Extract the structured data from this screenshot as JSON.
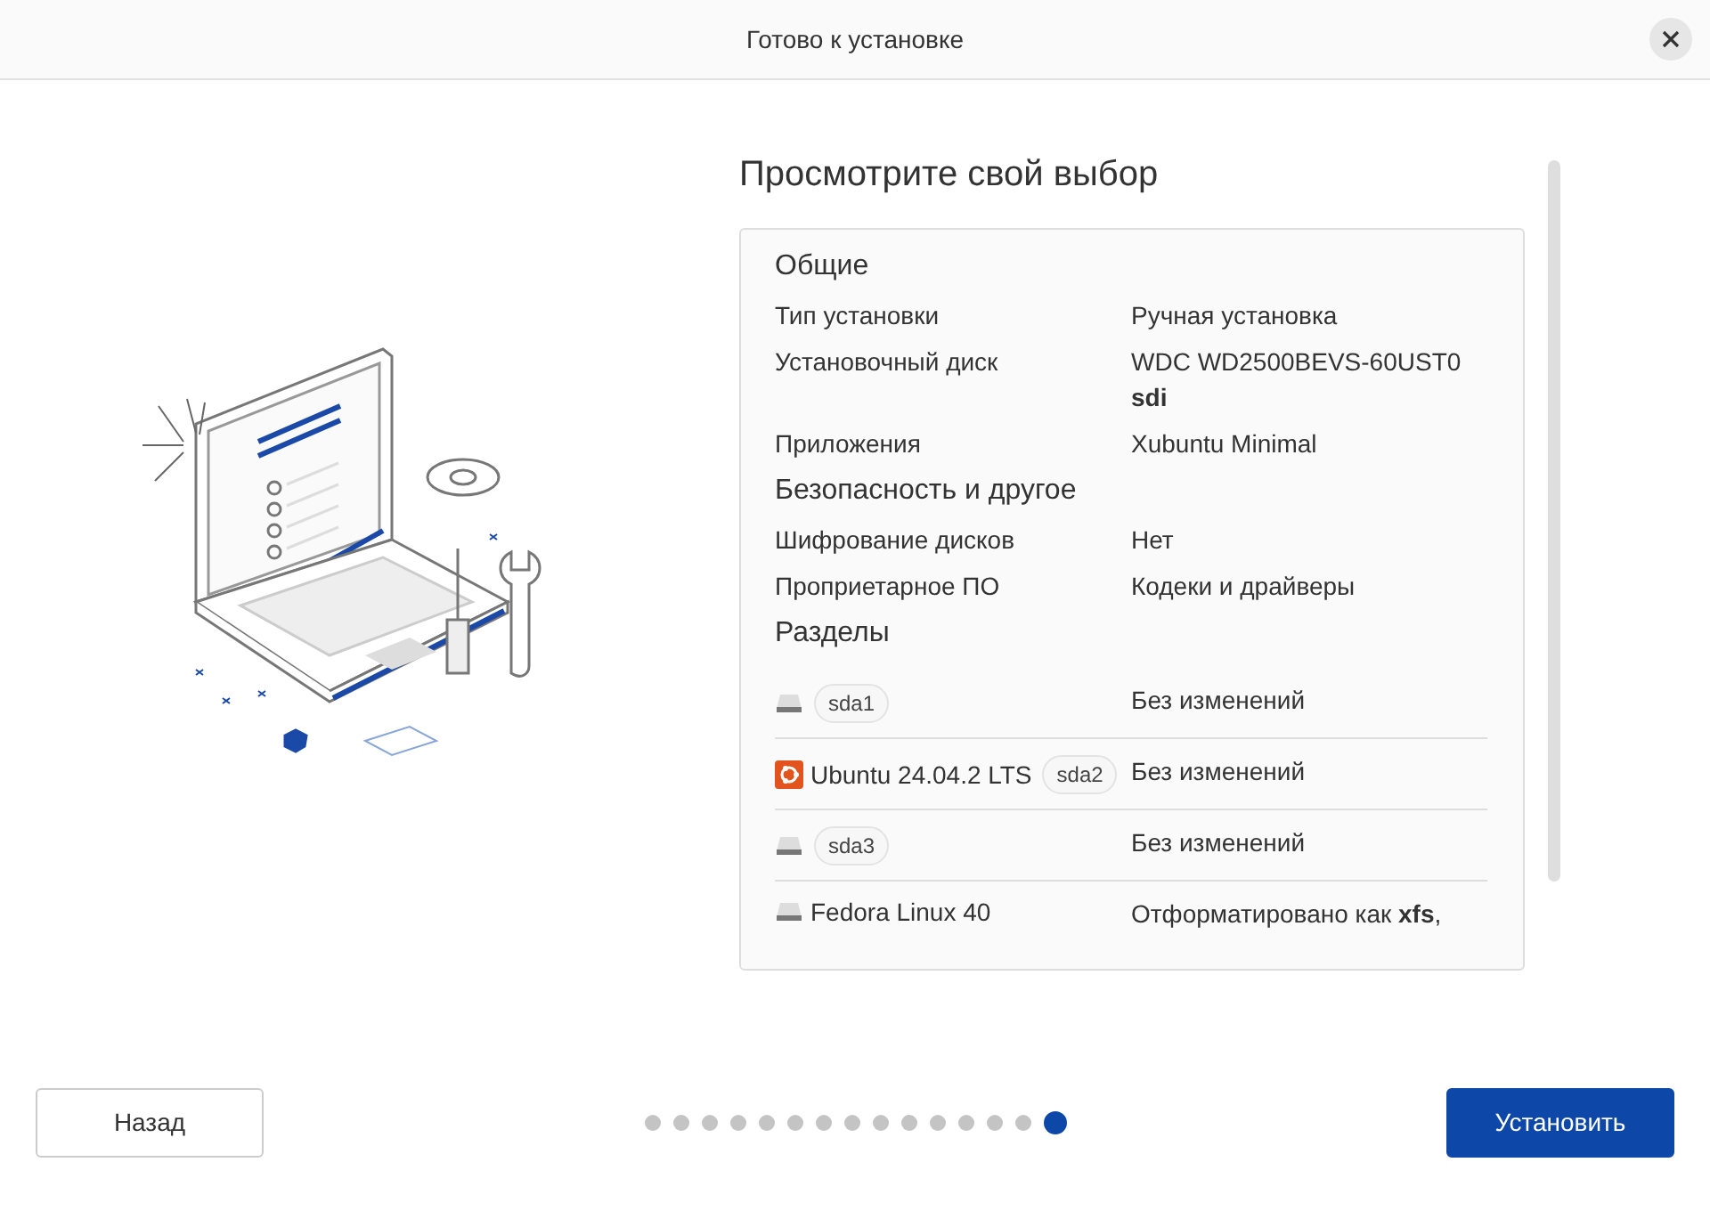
{
  "window": {
    "title": "Готово к установке"
  },
  "heading": "Просмотрите свой выбор",
  "sections": [
    {
      "title": "Общие",
      "rows": [
        {
          "label": "Тип установки",
          "value": "Ручная установка"
        },
        {
          "label": "Установочный диск",
          "value": "WDC WD2500BEVS-60UST0",
          "detail": "sdi"
        },
        {
          "label": "Приложения",
          "value": "Xubuntu Minimal"
        }
      ]
    },
    {
      "title": "Безопасность и другое",
      "rows": [
        {
          "label": "Шифрование дисков",
          "value": "Нет"
        },
        {
          "label": "Проприетарное ПО",
          "value": "Кодеки и драйверы"
        }
      ]
    }
  ],
  "partitions": {
    "title": "Разделы",
    "rows": [
      {
        "kind": "disk",
        "device": "sda1",
        "status": "Без изменений"
      },
      {
        "kind": "ubuntu",
        "name": "Ubuntu 24.04.2 LTS",
        "device": "sda2",
        "status": "Без изменений"
      },
      {
        "kind": "disk",
        "device": "sda3",
        "status": "Без изменений"
      },
      {
        "kind": "disk",
        "name": "Fedora Linux 40",
        "status": "Отформатировано как **xfs**,"
      }
    ]
  },
  "steps": [
    {
      "selected": false
    },
    {
      "selected": false
    },
    {
      "selected": false
    },
    {
      "selected": false
    },
    {
      "selected": false
    },
    {
      "selected": false
    },
    {
      "selected": false
    },
    {
      "selected": false
    },
    {
      "selected": false
    },
    {
      "selected": false
    },
    {
      "selected": false
    },
    {
      "selected": false
    },
    {
      "selected": false
    },
    {
      "selected": false
    },
    {
      "selected": true
    }
  ],
  "buttons": {
    "back": "Назад",
    "install": "Установить"
  }
}
